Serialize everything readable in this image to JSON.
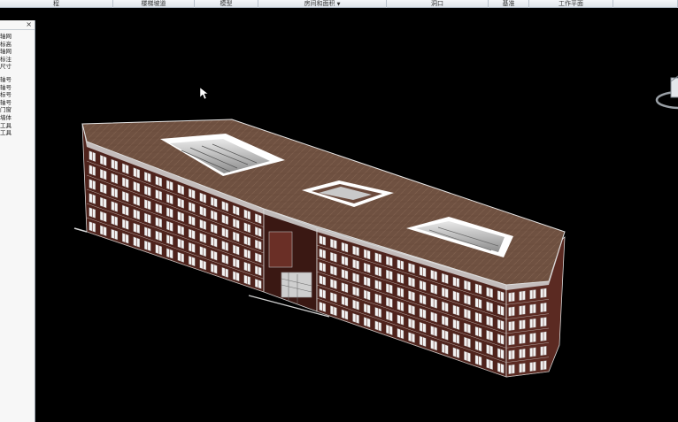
{
  "ribbon": {
    "panels": [
      {
        "label": "程",
        "width": 128
      },
      {
        "label": "楼梯坡道",
        "width": 92
      },
      {
        "label": "模型",
        "width": 72
      },
      {
        "label": "房间和面积",
        "width": 145,
        "dropdown": true
      },
      {
        "label": "洞口",
        "width": 115
      },
      {
        "label": "基准",
        "width": 46
      },
      {
        "label": "工作平面",
        "width": 95
      },
      {
        "label": "",
        "width": 73
      }
    ]
  },
  "browser": {
    "close_label": "×",
    "items_group1": [
      "轴网",
      "标高",
      "轴网",
      "标注",
      "尺寸"
    ],
    "items_group2": [
      "轴号",
      "轴号",
      "标号",
      "轴号",
      "门窗",
      "墙体",
      "工具",
      "工具"
    ]
  },
  "viewport": {
    "background": "#000000",
    "model": "3D building model",
    "roof_color": "#6e5040",
    "wall_color": "#5a2a22"
  }
}
